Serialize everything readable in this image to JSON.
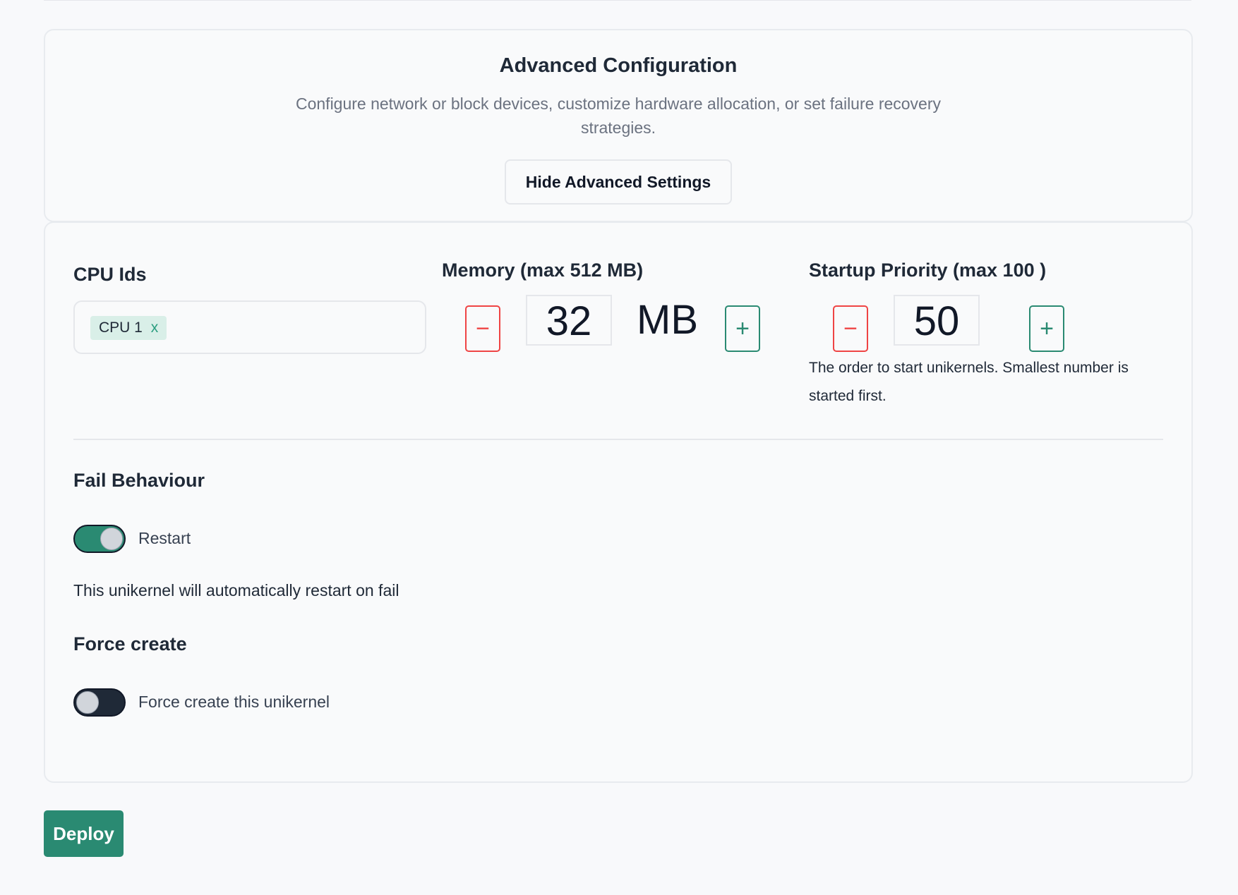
{
  "advanced": {
    "title": "Advanced Configuration",
    "description": "Configure network or block devices, customize hardware allocation, or set failure recovery strategies.",
    "hide_button": "Hide Advanced Settings"
  },
  "cpu": {
    "label": "CPU Ids",
    "tags": [
      {
        "label": "CPU 1",
        "remove": "x"
      }
    ]
  },
  "memory": {
    "label": "Memory (max 512 MB)",
    "minus": "−",
    "plus": "+",
    "value": "32",
    "unit": "MB"
  },
  "priority": {
    "label": "Startup Priority (max 100 )",
    "minus": "−",
    "plus": "+",
    "value": "50",
    "help": "The order to start unikernels. Smallest number is started first."
  },
  "fail_behaviour": {
    "label": "Fail Behaviour",
    "toggle_label": "Restart",
    "enabled": true,
    "info": "This unikernel will automatically restart on fail"
  },
  "force_create": {
    "label": "Force create",
    "toggle_label": "Force create this unikernel",
    "enabled": false
  },
  "deploy": {
    "label": "Deploy"
  },
  "colors": {
    "accent": "#2a8a72",
    "danger": "#ef4444",
    "tag_bg": "#d9efe8"
  }
}
